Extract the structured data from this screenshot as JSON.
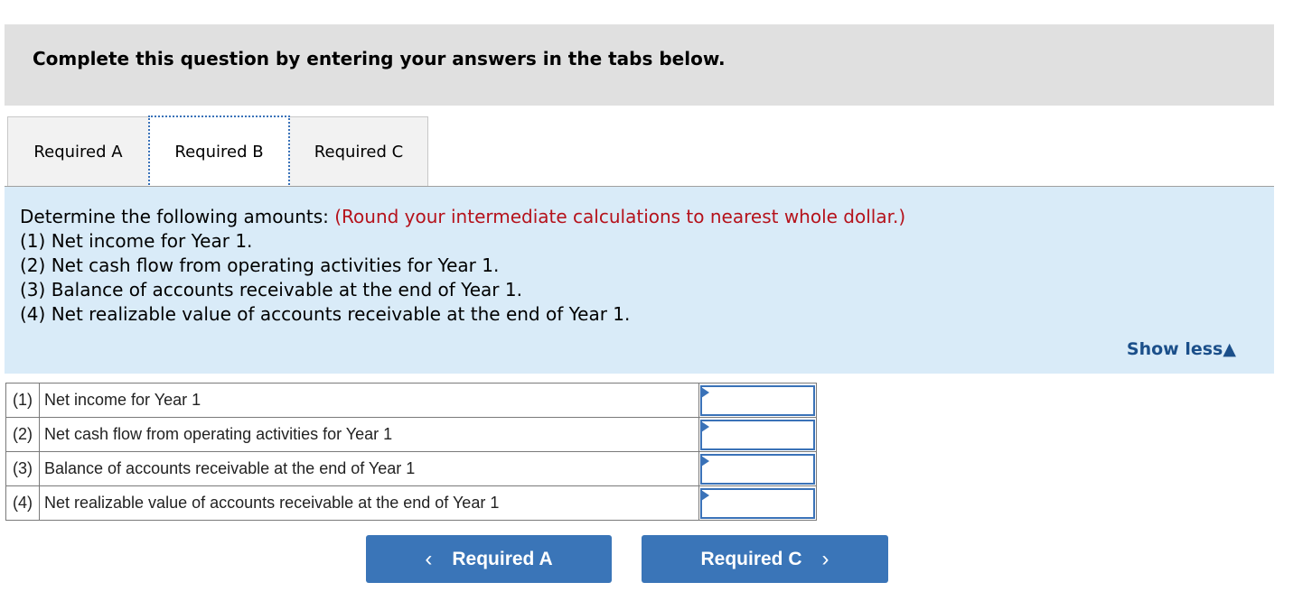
{
  "header": {
    "title": "Complete this question by entering your answers in the tabs below."
  },
  "tabs": [
    {
      "label": "Required A",
      "active": false
    },
    {
      "label": "Required B",
      "active": true
    },
    {
      "label": "Required C",
      "active": false
    }
  ],
  "instructions": {
    "intro": "Determine the following amounts: ",
    "note": "(Round your intermediate calculations to nearest whole dollar.)",
    "items": [
      "(1) Net income for Year 1.",
      "(2) Net cash flow from operating activities for Year 1.",
      "(3) Balance of accounts receivable at the end of Year 1.",
      "(4) Net realizable value of accounts receivable at the end of Year 1."
    ],
    "toggle_label": "Show less",
    "toggle_icon": "triangle-up-icon",
    "toggle_glyph": "▲"
  },
  "answer_table": {
    "rows": [
      {
        "num": "(1)",
        "label": "Net income for Year 1",
        "value": ""
      },
      {
        "num": "(2)",
        "label": "Net cash flow from operating activities for Year 1",
        "value": ""
      },
      {
        "num": "(3)",
        "label": "Balance of accounts receivable at the end of Year 1",
        "value": ""
      },
      {
        "num": "(4)",
        "label": "Net realizable value of accounts receivable at the end of Year 1",
        "value": ""
      }
    ]
  },
  "navigation": {
    "prev_label": "Required A",
    "prev_glyph": "‹",
    "next_label": "Required C",
    "next_glyph": "›"
  },
  "colors": {
    "accent": "#3a75b8",
    "note_red": "#b5121b",
    "instructions_bg": "#d9ebf8",
    "header_bg": "#e0e0e0",
    "link": "#1b4f8a"
  }
}
